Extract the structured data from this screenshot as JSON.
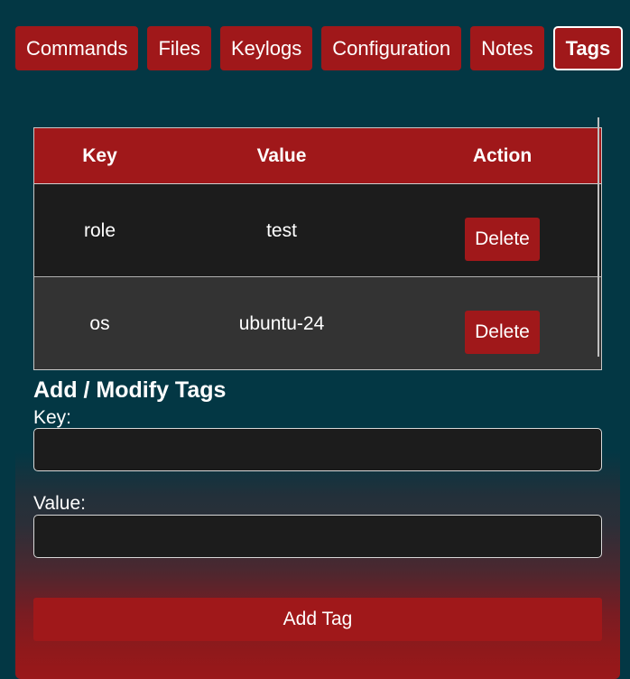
{
  "tabs": [
    {
      "label": "Commands"
    },
    {
      "label": "Files"
    },
    {
      "label": "Keylogs"
    },
    {
      "label": "Configuration"
    },
    {
      "label": "Notes"
    },
    {
      "label": "Tags",
      "active": true
    }
  ],
  "table": {
    "headers": {
      "key": "Key",
      "value": "Value",
      "action": "Action"
    },
    "rows": [
      {
        "key": "role",
        "value": "test",
        "action": "Delete"
      },
      {
        "key": "os",
        "value": "ubuntu-24",
        "action": "Delete"
      }
    ]
  },
  "form": {
    "title": "Add / Modify Tags",
    "key_label": "Key:",
    "key_value": "",
    "value_label": "Value:",
    "value_value": "",
    "submit_label": "Add Tag"
  },
  "colors": {
    "background": "#033744",
    "accent": "#a0181a",
    "row_dark": "#1c1c1c",
    "row_mid": "#333333"
  }
}
